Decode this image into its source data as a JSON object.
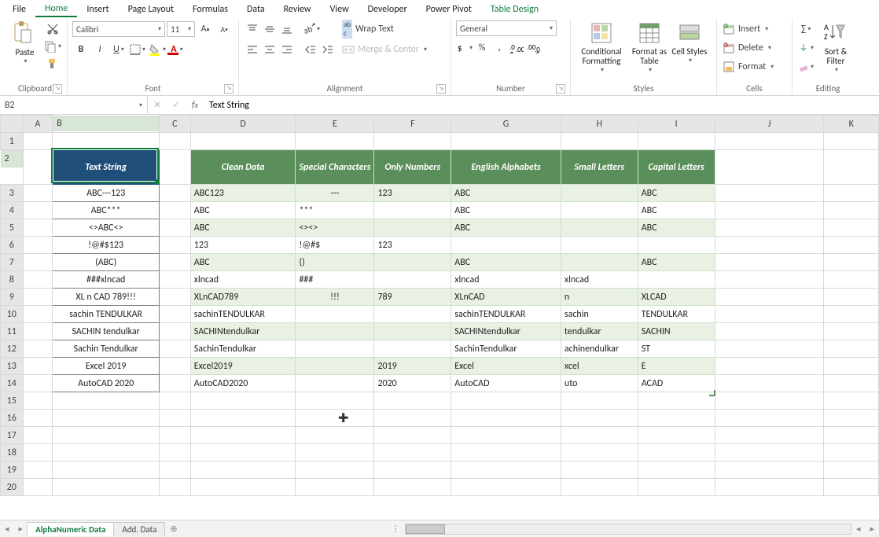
{
  "tabs": {
    "file": "File",
    "home": "Home",
    "insert": "Insert",
    "pagelayout": "Page Layout",
    "formulas": "Formulas",
    "data": "Data",
    "review": "Review",
    "view": "View",
    "developer": "Developer",
    "powerpivot": "Power Pivot",
    "tabledesign": "Table Design"
  },
  "ribbon": {
    "clipboard": {
      "label": "Clipboard",
      "paste": "Paste"
    },
    "font": {
      "label": "Font",
      "face": "Calibri",
      "size": "11"
    },
    "alignment": {
      "label": "Alignment",
      "wrap": "Wrap Text",
      "merge": "Merge & Center"
    },
    "number": {
      "label": "Number",
      "format": "General"
    },
    "styles": {
      "label": "Styles",
      "cond": "Conditional Formatting",
      "fmttbl": "Format as Table",
      "cell": "Cell Styles"
    },
    "cells": {
      "label": "Cells",
      "insert": "Insert",
      "delete": "Delete",
      "format": "Format"
    },
    "editing": {
      "label": "Editing",
      "sort": "Sort & Filter"
    }
  },
  "namebox": "B2",
  "formula": "Text String",
  "cols": [
    "A",
    "B",
    "C",
    "D",
    "E",
    "F",
    "G",
    "H",
    "I",
    "J",
    "K"
  ],
  "b_header": "Text String",
  "green_headers": [
    "Clean Data",
    "Special Characters",
    "Only Numbers",
    "English Alphabets",
    "Small Letters",
    "Capital Letters"
  ],
  "rows": [
    {
      "r": 3,
      "b": "ABC---123",
      "d": "ABC123",
      "e": "---",
      "f": "123",
      "g": "ABC",
      "h": "",
      "i": "ABC"
    },
    {
      "r": 4,
      "b": "ABC***",
      "d": "ABC",
      "e": "***",
      "f": "",
      "g": "ABC",
      "h": "",
      "i": "ABC"
    },
    {
      "r": 5,
      "b": "<>ABC<>",
      "d": "ABC",
      "e": "<><>",
      "f": "",
      "g": "ABC",
      "h": "",
      "i": "ABC"
    },
    {
      "r": 6,
      "b": "!@#$123",
      "d": "123",
      "e": "!@#$",
      "f": "123",
      "g": "",
      "h": "",
      "i": ""
    },
    {
      "r": 7,
      "b": "(ABC)",
      "d": "ABC",
      "e": "()",
      "f": "",
      "g": "ABC",
      "h": "",
      "i": "ABC"
    },
    {
      "r": 8,
      "b": "###xlncad",
      "d": "xlncad",
      "e": "###",
      "f": "",
      "g": "xlncad",
      "h": "xlncad",
      "i": ""
    },
    {
      "r": 9,
      "b": "XL n CAD 789!!!",
      "d": "XLnCAD789",
      "e": "!!!",
      "f": "789",
      "g": "XLnCAD",
      "h": "n",
      "i": "XLCAD"
    },
    {
      "r": 10,
      "b": "sachin TENDULKAR",
      "d": "sachinTENDULKAR",
      "e": "",
      "f": "",
      "g": "sachinTENDULKAR",
      "h": "sachin",
      "i": "TENDULKAR"
    },
    {
      "r": 11,
      "b": "SACHIN tendulkar",
      "d": "SACHINtendulkar",
      "e": "",
      "f": "",
      "g": "SACHINtendulkar",
      "h": "tendulkar",
      "i": "SACHIN"
    },
    {
      "r": 12,
      "b": "Sachin Tendulkar",
      "d": "SachinTendulkar",
      "e": "",
      "f": "",
      "g": "SachinTendulkar",
      "h": "achinendulkar",
      "i": "ST"
    },
    {
      "r": 13,
      "b": "Excel 2019",
      "d": "Excel2019",
      "e": "",
      "f": "2019",
      "g": "Excel",
      "h": "xcel",
      "i": "E"
    },
    {
      "r": 14,
      "b": "AutoCAD 2020",
      "d": "AutoCAD2020",
      "e": "",
      "f": "2020",
      "g": "AutoCAD",
      "h": "uto",
      "i": "ACAD"
    }
  ],
  "sheets": {
    "active": "AlphaNumeric Data",
    "other": "Add. Data"
  }
}
